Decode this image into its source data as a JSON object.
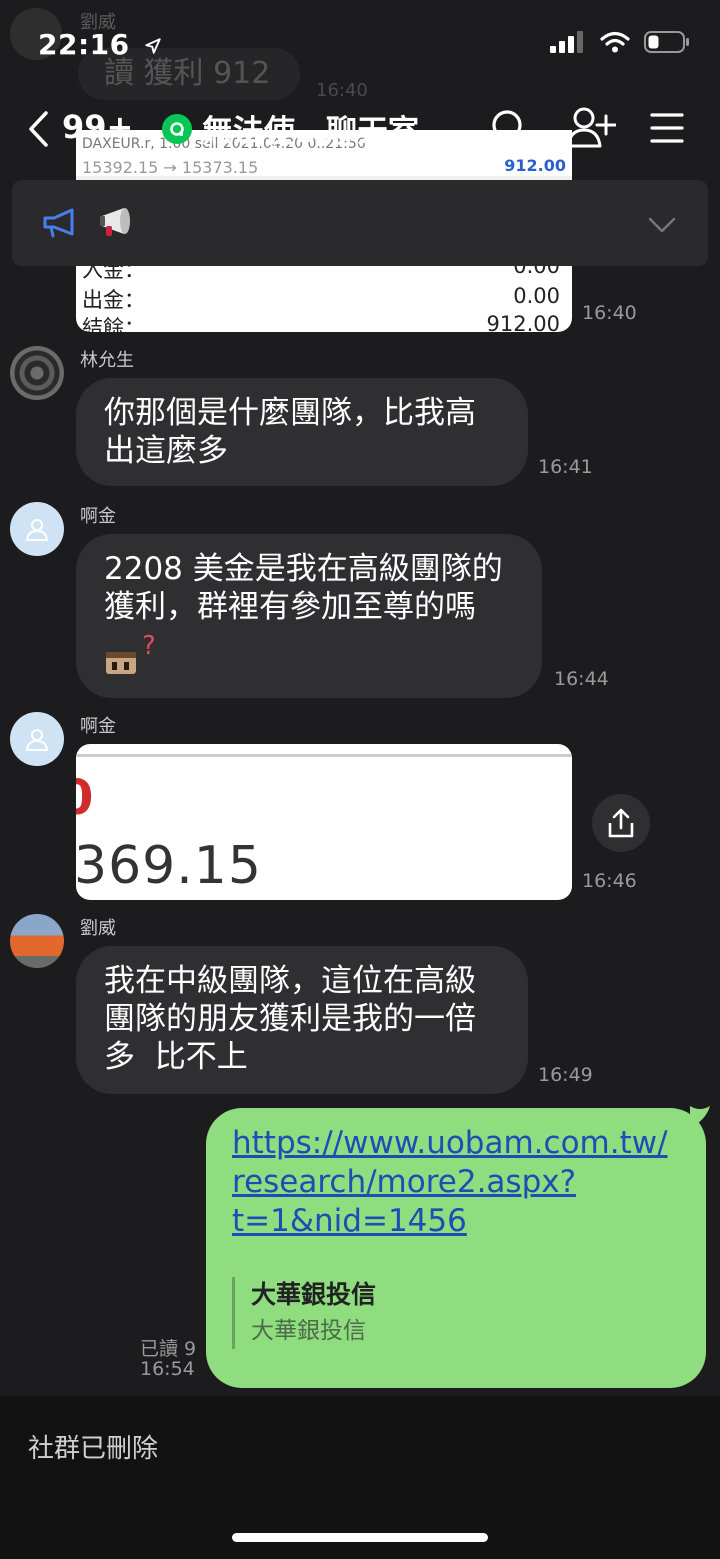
{
  "status": {
    "time": "22:16"
  },
  "ghost": {
    "name": "劉威",
    "bubble": "讀 獲利 912",
    "time": "16:40"
  },
  "header": {
    "back_count": "99+",
    "title": "無法使…聊天室"
  },
  "receipt": {
    "row1": "DAXEUR.r, 1.00  sell 2021.04.20 0..21:56",
    "row1_val": "912.00",
    "row2": "15392.15 → 15373.15",
    "rows": [
      {
        "label": "入金：",
        "value": "0.00"
      },
      {
        "label": "出金：",
        "value": "0.00"
      },
      {
        "label": "結餘：",
        "value": "912.00"
      }
    ],
    "time": "16:40"
  },
  "messages": [
    {
      "sender": "林允生",
      "text_line1": "你那個是什麼團隊，比我高",
      "text_line2": "出這麼多",
      "time": "16:41"
    },
    {
      "sender": "啊金",
      "text_line1": "2208 美金是我在高級團隊的",
      "text_line2": "獲利，群裡有參加至尊的嗎",
      "time": "16:44"
    },
    {
      "sender": "啊金",
      "img_top": "0",
      "img_value": "369.15",
      "time": "16:46"
    },
    {
      "sender": "劉威",
      "text_line1": "我在中級團隊，這位在高級",
      "text_line2": "團隊的朋友獲利是我的一倍",
      "text_line3": "多  比不上",
      "time": "16:49"
    }
  ],
  "mine": {
    "link_line1": "https://www.uobam.com.tw/",
    "link_line2": "research/more2.aspx?",
    "link_line3": "t=1&nid=1456",
    "preview_title": "大華銀投信",
    "preview_sub": "大華銀投信",
    "read": "已讀 9",
    "time": "16:54"
  },
  "footer": {
    "text": "社群已刪除"
  },
  "colors": {
    "accent_green": "#06c755",
    "my_bubble": "#8fdd7f",
    "link": "#1d4db7",
    "megaphone_blue": "#4a7df0"
  }
}
